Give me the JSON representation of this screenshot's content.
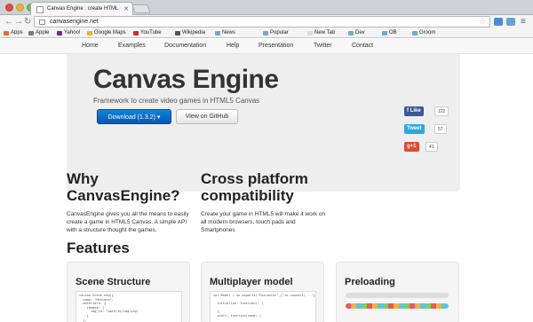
{
  "browser": {
    "tab_title": "Canvas Engine : create HTML",
    "url": "canvasengine.net"
  },
  "bookmarks": [
    {
      "label": "Apps",
      "color": "#e26d2c"
    },
    {
      "label": "Apple",
      "color": "#7a7a7a"
    },
    {
      "label": "Yahoo!",
      "color": "#7b1fa2"
    },
    {
      "label": "Google Maps",
      "color": "#f2b51e"
    },
    {
      "label": "YouTube",
      "color": "#d62727"
    },
    {
      "label": "Wikipedia",
      "color": "#555"
    },
    {
      "label": "News",
      "color": "#7aa2d6"
    },
    {
      "label": "Popular",
      "color": "#7aa2d6"
    },
    {
      "label": "New Tab",
      "color": "#dddddd"
    },
    {
      "label": "Dev",
      "color": "#7aa2d6"
    },
    {
      "label": "OB",
      "color": "#7aa2d6"
    },
    {
      "label": "Groom",
      "color": "#7aa2d6"
    }
  ],
  "nav": [
    "Home",
    "Examples",
    "Documentation",
    "Help",
    "Presentation",
    "Twitter",
    "Contact"
  ],
  "hero": {
    "title": "Canvas Engine",
    "subtitle": "Framework to create video games in HTML5 Canvas",
    "download_label": "Download (1.3.2) ▾",
    "github_label": "View on GitHub"
  },
  "social": [
    {
      "label": "f Like",
      "count": "122",
      "color": "#3b5998"
    },
    {
      "label": "Tweet",
      "count": "57",
      "color": "#2ba9e1"
    },
    {
      "label": "g+1",
      "count": "41",
      "color": "#dd4b39"
    }
  ],
  "sections": [
    {
      "title": "Why CanvasEngine?",
      "body": "CanvasEngine gives you all the means to easily create a game in HTML5 Canvas. A simple API with a structure thought the games."
    },
    {
      "title": "Cross platform compatibility",
      "body": "Create your game in HTML5 will make it work on all modern browsers, touch pads and Smartphones"
    }
  ],
  "features_title": "Features",
  "cards": [
    {
      "title": "Scene Structure",
      "code": "canvas.Scene.new({\n  name: \"MyScene\",\n  materials: {\n    images: {\n      img_id: \"path/to/img.png\"\n    }\n  },"
    },
    {
      "title": "Multiplayer model",
      "code": "var Model = io.exports(\"Character\",{\"io.connect(...\"}, {\n\n  initialize: function() {\n\n  },\n  start: function(name) {"
    },
    {
      "title": "Preloading",
      "code": ""
    }
  ]
}
